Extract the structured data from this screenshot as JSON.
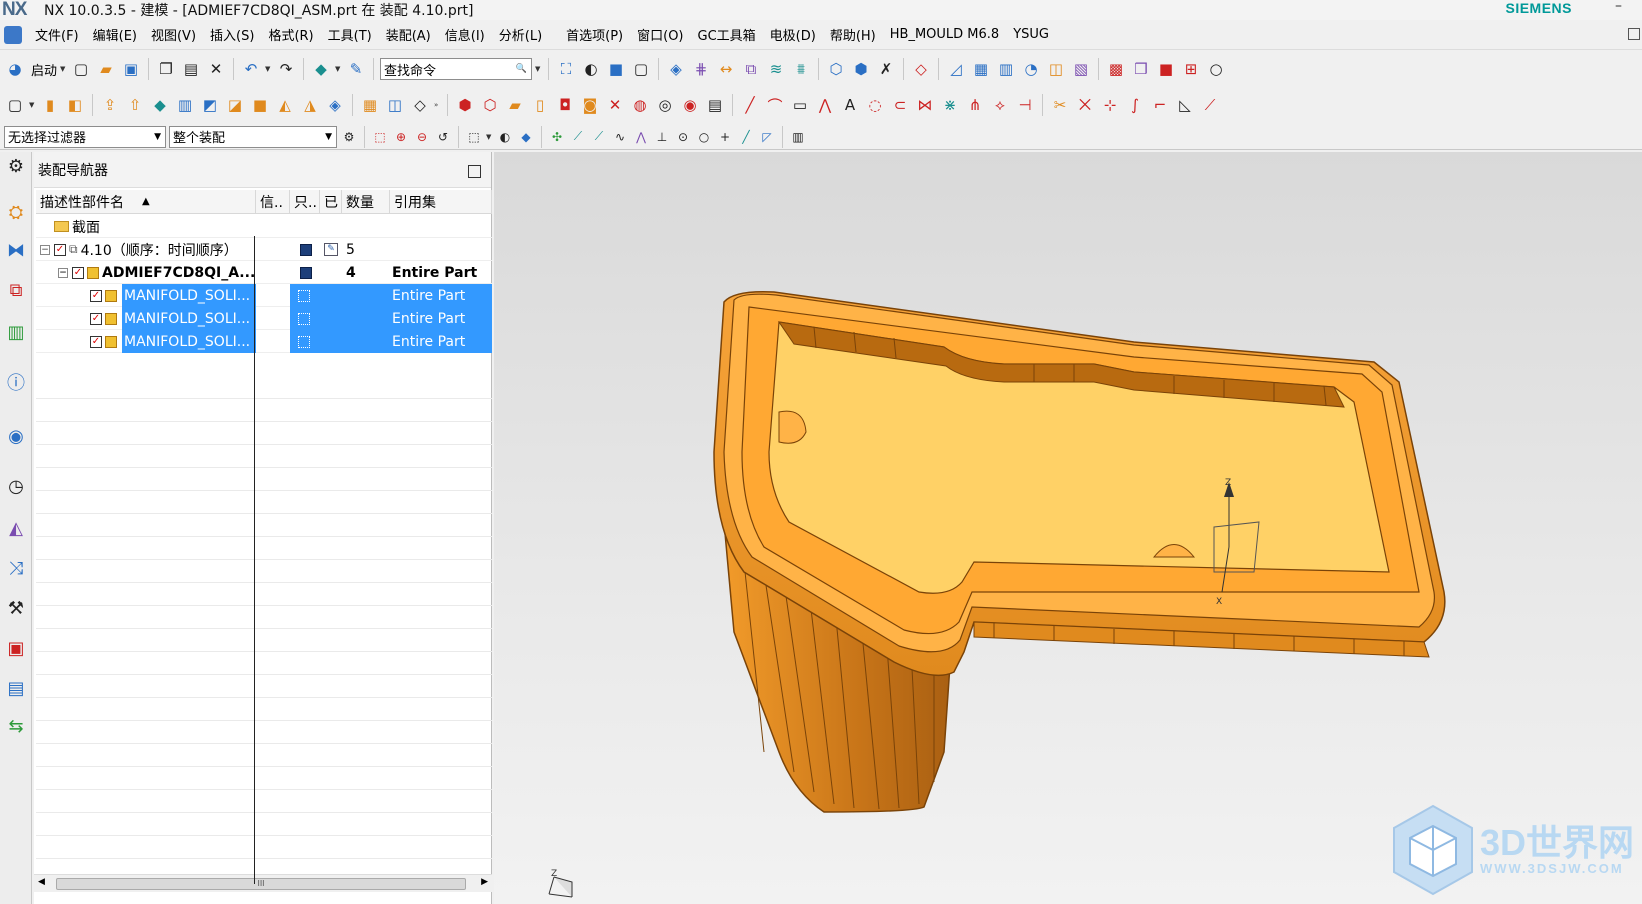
{
  "app": {
    "logo": "NX",
    "window_title": "NX 10.0.3.5 - 建模 - [ADMIEF7CD8QI_ASM.prt 在 装配 4.10.prt]",
    "brand": "SIEMENS",
    "minimize": "–"
  },
  "menu": {
    "items": [
      "文件(F)",
      "编辑(E)",
      "视图(V)",
      "插入(S)",
      "格式(R)",
      "工具(T)",
      "装配(A)",
      "信息(I)",
      "分析(L)"
    ],
    "items2": [
      "首选项(P)",
      "窗口(O)",
      "GC工具箱",
      "电极(D)",
      "帮助(H)",
      "HB_MOULD M6.8",
      "YSUG"
    ]
  },
  "toolbar": {
    "start_label": "启动",
    "command_search_placeholder": "查找命令",
    "search_icon": "magnifier-icon"
  },
  "selection_bar": {
    "filter_value": "无选择过滤器",
    "scope_value": "整个装配"
  },
  "navigator": {
    "title": "装配导航器",
    "columns": [
      "描述性部件名",
      "信..",
      "只..",
      "已",
      "数量",
      "引用集"
    ],
    "sort_indicator": "▲",
    "rows": [
      {
        "name": "截面",
        "count": "",
        "refset": ""
      },
      {
        "name": "4.10（顺序：时间顺序）",
        "count": "5",
        "refset": ""
      },
      {
        "name": "ADMIEF7CD8QI_A...",
        "count": "4",
        "refset": "Entire Part"
      },
      {
        "name": "MANIFOLD_SOLI...",
        "count": "",
        "refset": "Entire Part"
      },
      {
        "name": "MANIFOLD_SOLI...",
        "count": "",
        "refset": "Entire Part"
      },
      {
        "name": "MANIFOLD_SOLI...",
        "count": "",
        "refset": "Entire Part"
      }
    ],
    "scroll_thumb_label": "III"
  },
  "viewport": {
    "triad_z": "Z",
    "triad_x": "X",
    "watermark_text": "3D世界网",
    "watermark_url": "WWW.3DSJW.COM",
    "model_color": "#f5a623",
    "model_top_color": "#ffd166"
  },
  "colors": {
    "selection": "#3399ff",
    "brand": "#009999"
  }
}
